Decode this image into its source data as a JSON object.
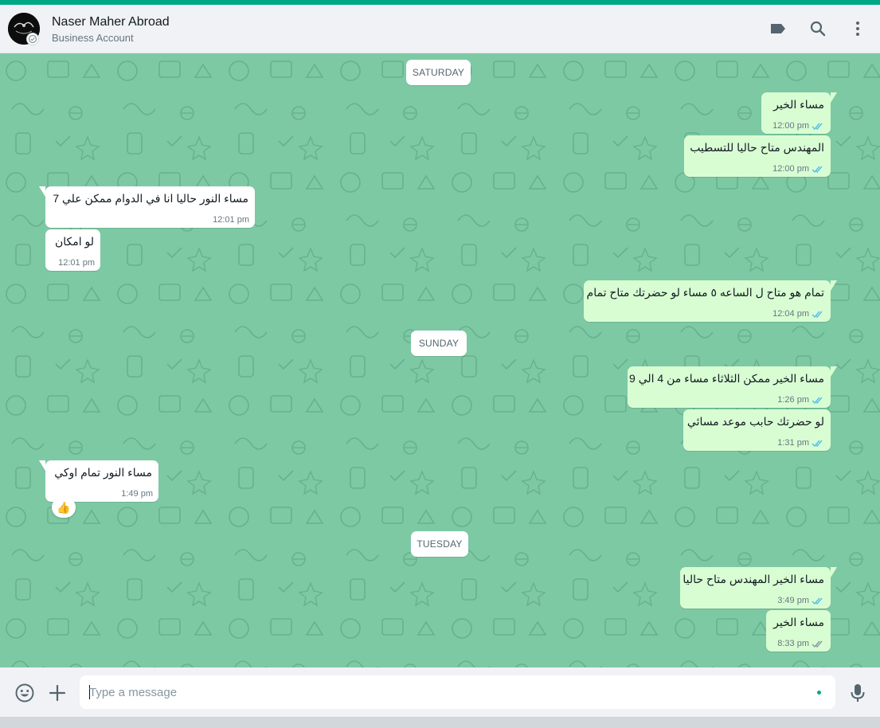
{
  "header": {
    "contact_name": "Naser Maher Abroad",
    "contact_subtitle": "Business Account",
    "icons": [
      "label-icon",
      "search-icon",
      "menu-icon"
    ]
  },
  "colors": {
    "accent": "#00a884",
    "wallpaper": "#7dc9a4",
    "outgoing_bubble": "#d9fdd3",
    "incoming_bubble": "#ffffff",
    "read_tick": "#53bdeb"
  },
  "days": [
    "SATURDAY",
    "SUNDAY",
    "TUESDAY"
  ],
  "messages": [
    {
      "dir": "out",
      "text": "مساء الخير",
      "time": "12:00 pm"
    },
    {
      "dir": "out",
      "text": "المهندس متاح حاليا للتسطيب",
      "time": "12:00 pm"
    },
    {
      "dir": "in",
      "text": "مساء النور  حاليا انا في الدوام ممكن علي 7",
      "time": "12:01 pm"
    },
    {
      "dir": "in",
      "text": "لو امكان",
      "time": "12:01 pm"
    },
    {
      "dir": "out",
      "text": "تمام هو متاح ل الساعه ٥ مساء لو حضرتك متاح تمام",
      "time": "12:04 pm"
    },
    {
      "dir": "out",
      "text": "مساء الخير ممكن الثلاثاء مساء من 4 الي 9",
      "time": "1:26 pm"
    },
    {
      "dir": "out",
      "text": "لو حضرتك حابب موعد مسائي",
      "time": "1:31 pm"
    },
    {
      "dir": "in",
      "text": "مساء النور تمام  اوكي",
      "time": "1:49 pm",
      "reaction": "👍"
    },
    {
      "dir": "out",
      "text": "مساء الخير المهندس متاح حاليا",
      "time": "3:49 pm"
    },
    {
      "dir": "out",
      "text": "مساء الخير",
      "time": "8:33 pm"
    }
  ],
  "composer": {
    "placeholder": "Type a message",
    "icons": [
      "emoji-icon",
      "attach-plus-icon",
      "microphone-icon"
    ]
  }
}
